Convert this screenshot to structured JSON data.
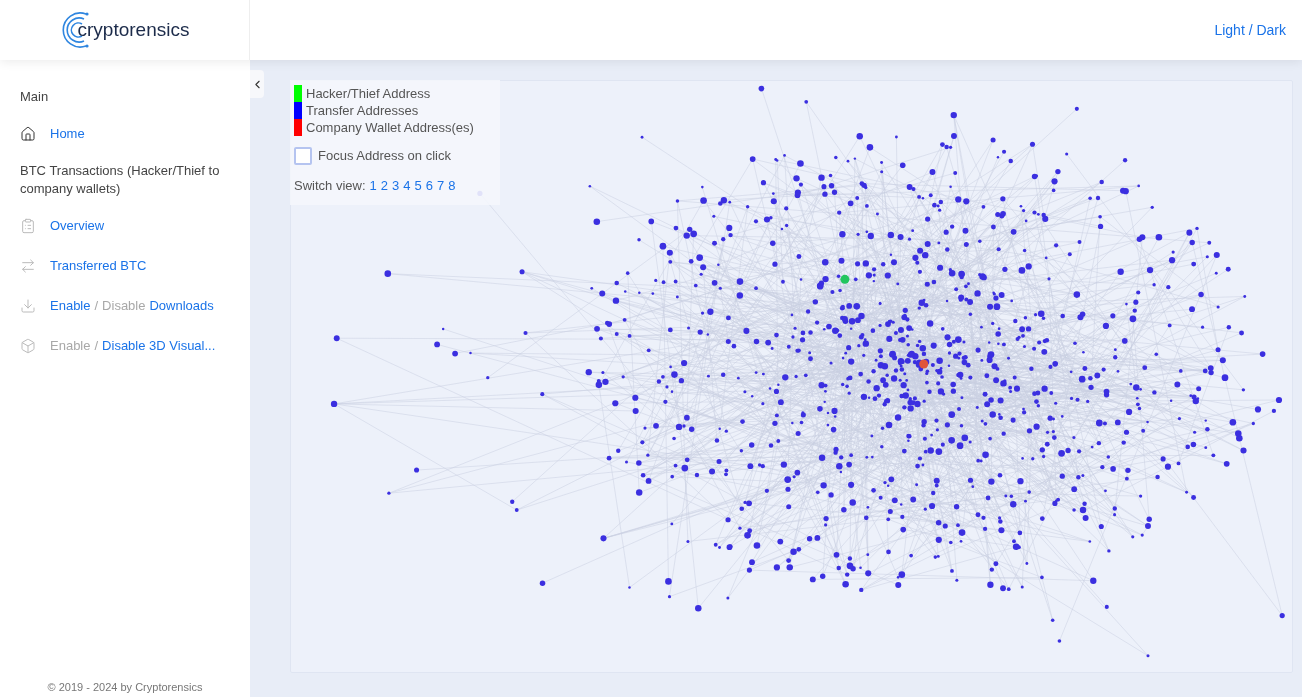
{
  "logo": {
    "text": "cryptorensics"
  },
  "header": {
    "theme_toggle": "Light / Dark"
  },
  "sidebar": {
    "sections": [
      {
        "title": "Main",
        "items": [
          {
            "kind": "link",
            "text": "Home"
          }
        ]
      },
      {
        "title": "BTC Transactions (Hacker/Thief to company wallets)",
        "items": [
          {
            "kind": "link",
            "text": "Overview"
          },
          {
            "kind": "link",
            "text": "Transferred BTC"
          },
          {
            "kind": "toggle",
            "parts": [
              {
                "text": "Enable",
                "disabled": false
              },
              {
                "text": "/",
                "disabled": true
              },
              {
                "text": "Disable",
                "disabled": true
              },
              {
                "text": "Downloads",
                "disabled": false
              }
            ]
          },
          {
            "kind": "toggle",
            "parts": [
              {
                "text": "Enable",
                "disabled": true
              },
              {
                "text": "/",
                "disabled": true
              },
              {
                "text": "Disable 3D Visual...",
                "disabled": false
              }
            ]
          }
        ]
      }
    ],
    "footer": "© 2019 - 2024 by Cryptorensics"
  },
  "graph": {
    "legend": [
      {
        "label": "Hacker/Thief Address",
        "color": "#00ff00"
      },
      {
        "label": "Transfer Addresses",
        "color": "#0000ff"
      },
      {
        "label": "Company Wallet Address(es)",
        "color": "#ff0000"
      }
    ],
    "focus_checkbox": {
      "label": "Focus Address on click",
      "checked": false
    },
    "switch_view": {
      "label": "Switch view:",
      "options": [
        "1",
        "2",
        "3",
        "4",
        "5",
        "6",
        "7",
        "8"
      ]
    }
  }
}
